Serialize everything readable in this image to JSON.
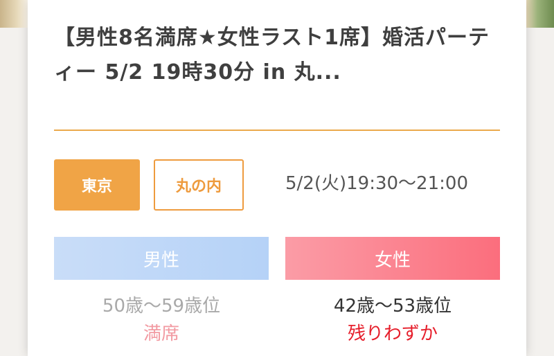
{
  "event": {
    "title": "【男性8名満席★女性ラスト1席】婚活パーティー 5/2 19時30分 in 丸...",
    "prefecture_tag": "東京",
    "area_tag": "丸の内",
    "datetime": "5/2(火)19:30〜21:00"
  },
  "male": {
    "label": "男性",
    "age_range": "50歳〜59歳位",
    "status": "満席"
  },
  "female": {
    "label": "女性",
    "age_range": "42歳〜53歳位",
    "status": "残りわずか"
  },
  "colors": {
    "accent_orange": "#f0a446",
    "male_blue": "#b5d2f7",
    "female_pink": "#fb6e7d",
    "status_red": "#e61e2b"
  }
}
